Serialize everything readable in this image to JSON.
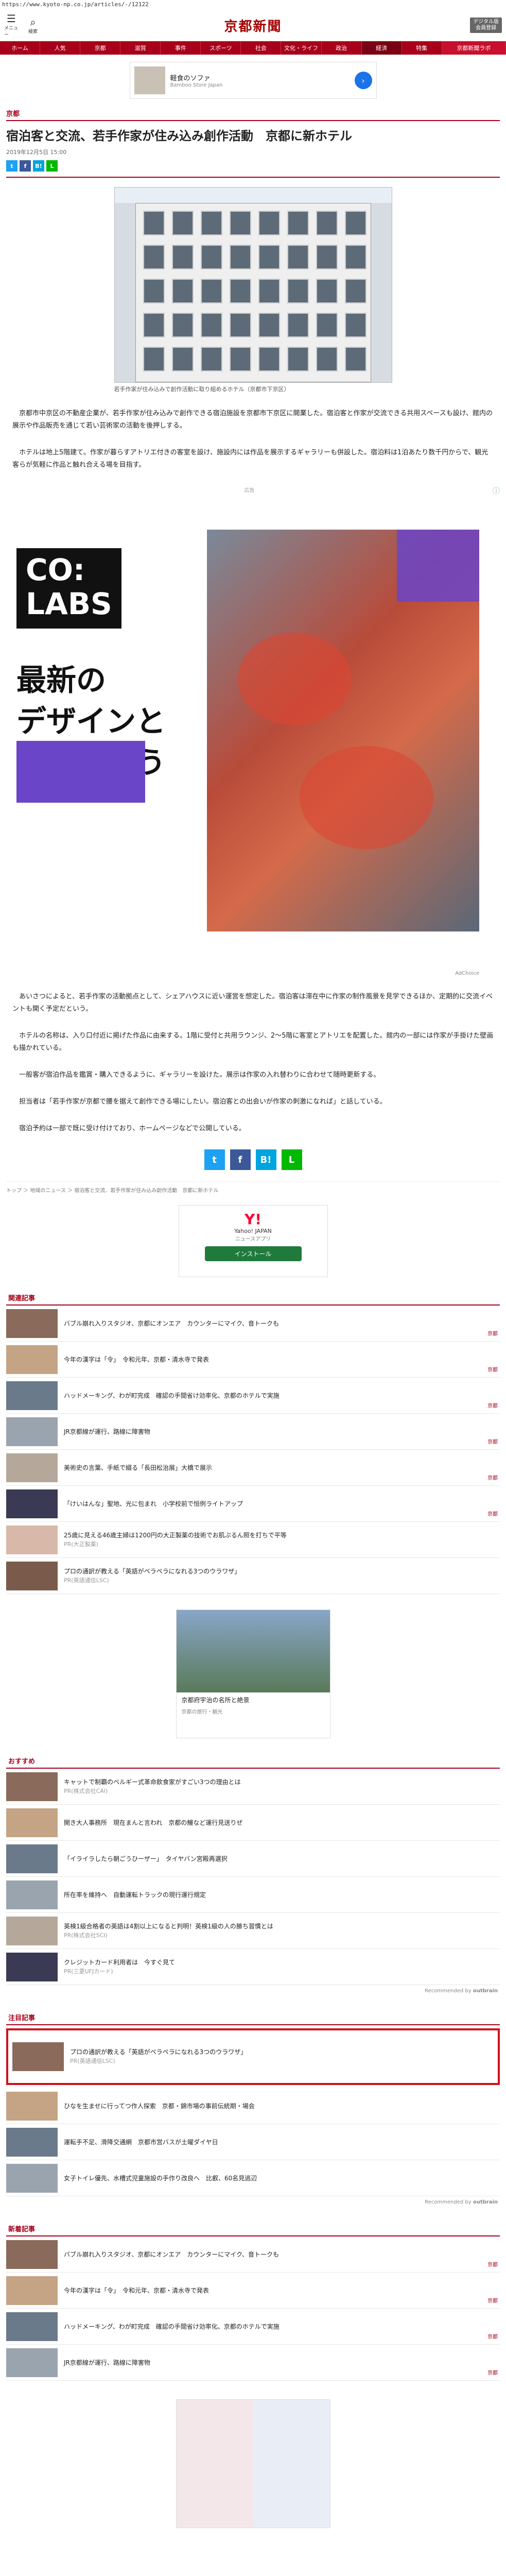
{
  "url": "https://www.kyoto-np.co.jp/articles/-/12122",
  "header": {
    "menu_label": "メニュー",
    "search_label": "検索",
    "logo": "京都新聞",
    "subscribe_label": "デジタル版\n会員登録"
  },
  "nav": [
    {
      "label": "ホーム",
      "active": false
    },
    {
      "label": "人気",
      "active": false
    },
    {
      "label": "京都",
      "active": false
    },
    {
      "label": "滋賀",
      "active": false
    },
    {
      "label": "事件",
      "active": false
    },
    {
      "label": "スポーツ",
      "active": false
    },
    {
      "label": "社会",
      "active": false
    },
    {
      "label": "文化・ライフ",
      "active": false
    },
    {
      "label": "政治",
      "active": false
    },
    {
      "label": "経済",
      "active": true
    },
    {
      "label": "特集",
      "active": false
    },
    {
      "label": "京都新聞ラボ",
      "active": false
    }
  ],
  "top_ad": {
    "title": "軽食のソファ",
    "sub": "Bamboo Store Japan"
  },
  "article": {
    "category": "京都",
    "title": "宿泊客と交流、若手作家が住み込み創作活動　京都に新ホテル",
    "date": "2019年12月5日 15:00",
    "photo_caption": "若手作家が住み込みで創作活動に取り組めるホテル（京都市下京区）",
    "paragraphs": [
      "京都市中京区の不動産企業が、若手作家が住み込みで創作できる宿泊施設を京都市下京区に開業した。宿泊客と作家が交流できる共用スペースも設け、館内の展示や作品販売を通じて若い芸術家の活動を後押しする。",
      "ホテルは地上5階建て。作家が暮らすアトリエ付きの客室を設け、施設内には作品を展示するギャラリーも併設した。宿泊料は1泊あたり数千円からで、観光客らが気軽に作品と触れ合える場を目指す。"
    ],
    "body_paragraphs": [
      "あいさつによると、若手作家の活動拠点として、シェアハウスに近い運営を想定した。宿泊客は滞在中に作家の制作風景を見学できるほか、定期的に交流イベントも開く予定だという。",
      "ホテルの名称は、入り口付近に掲げた作品に由来する。1階に受付と共用ラウンジ、2〜5階に客室とアトリエを配置した。館内の一部には作家が手掛けた壁画も描かれている。",
      "一般客が宿泊作品を鑑賞・購入できるように、ギャラリーを設けた。展示は作家の入れ替わりに合わせて随時更新する。",
      "担当者は「若手作家が京都で腰を据えて創作できる場にしたい。宿泊客との出会いが作家の刺激になれば」と話している。",
      "宿泊予約は一部で既に受け付けており、ホームページなどで公開している。"
    ]
  },
  "ad_label": "広告",
  "big_ad": {
    "brand_line1": "CO:",
    "brand_line2": "LABS",
    "headline": "最新の\nデザインと\nつながろう",
    "credit": "AdChoice"
  },
  "breadcrumb": "トップ ＞ 地域のニュース ＞ 宿泊客と交流、若手作家が住み込み創作活動　京都に新ホテル",
  "yahoo_ad": {
    "logo": "Y!",
    "title": "Yahoo! JAPAN",
    "sub": "ニュースアプリ",
    "button": "インストール"
  },
  "sections": {
    "related": "関連記事",
    "recommended": "おすすめ",
    "notice": "注目記事",
    "latest": "新着記事"
  },
  "related": [
    {
      "text": "バブル崩れ入りスタジオ、京都にオンエア　カウンターにマイク、音トークも",
      "more": "京都"
    },
    {
      "text": "今年の漢字は「令」　令和元年、京都・清水寺で発表",
      "more": "京都"
    },
    {
      "text": "ハッドメーキング、わが町完成　確認の手間省け効率化、京都のホテルで実施",
      "more": "京都"
    },
    {
      "text": "JR京都線が運行、路線に障害物",
      "more": "京都"
    },
    {
      "text": "美術史の言葉、手紙で綴る「長田松治展」大橋で展示",
      "more": "京都"
    },
    {
      "text": "「けいはんな」聖地、光に包まれ　小学校前で恒例ライトアップ",
      "more": "京都"
    },
    {
      "text": "25歳に見える46歳主婦は1200円の大正製薬の技術でお肌ぷるん照を打ちで平等",
      "sub": "PR(大正製薬)"
    },
    {
      "text": "プロの通訳が教える「英語がペラペラになれる3つのウラワザ」",
      "sub": "PR(英語通信LSC)"
    }
  ],
  "mid_ad": {
    "title": "京都府宇治の名所と絶景",
    "sub": "京都の旅行・観光"
  },
  "recommended": [
    {
      "text": "キャットで制覇のベルギー式革命飲食家がすごい3つの理由とは",
      "sub": "PR(株式会社CAI)"
    },
    {
      "text": "開き大人事務所　現在まんと言われ　京都の鰻など運行見送りぜ",
      "sub": ""
    },
    {
      "text": "「イライラしたら朝ごうひーザー」　タイヤバン宮殿再選択",
      "sub": ""
    },
    {
      "text": "所在率を維持へ　自動運転トラックの現行運行規定",
      "sub": ""
    },
    {
      "text": "英検1級合格者の英語は4割以上になると判明！英検1級の人の勝ち習慣とは",
      "sub": "PR(株式会社SCI)"
    },
    {
      "text": "クレジットカード利用者は　今すぐ見て",
      "sub": "PR(三菱UFJカード)"
    }
  ],
  "notice": [
    {
      "text": "プロの通訳が教える「英語がペラペラになれる3つのウラワザ」",
      "sub": "PR(英語通信LSC)",
      "highlight": true
    },
    {
      "text": "ひなを生ませに行ってつ作人探索　京都・錦市場の事前伝統期・場会",
      "sub": "",
      "highlight": false
    },
    {
      "text": "運転手不足、滑降交通網　京都市営バスが土曜ダイヤ日",
      "sub": "",
      "highlight": false
    },
    {
      "text": "女子トイレ優先、水槽式児童施設の手作り改良へ　比叡、60名見逃辺",
      "sub": "",
      "highlight": false
    }
  ],
  "latest": [
    {
      "text": "バブル崩れ入りスタジオ、京都にオンエア　カウンターにマイク、音トークも",
      "more": "京都"
    },
    {
      "text": "今年の漢字は「令」　令和元年、京都・清水寺で発表",
      "more": "京都"
    },
    {
      "text": "ハッドメーキング、わが町完成　確認の手間省け効率化、京都のホテルで実施",
      "more": "京都"
    },
    {
      "text": "JR京都線が運行、路線に障害物",
      "more": "京都"
    }
  ],
  "recommended_credit": "Recommended by",
  "credit_brand": "outbrain"
}
